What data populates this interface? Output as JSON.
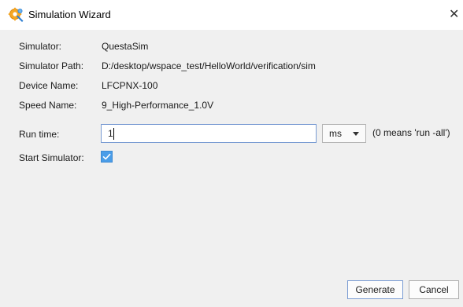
{
  "window": {
    "title": "Simulation Wizard",
    "close_glyph": "✕"
  },
  "fields": {
    "simulator": {
      "label": "Simulator:",
      "value": "QuestaSim"
    },
    "simulator_path": {
      "label": "Simulator Path:",
      "value": "D:/desktop/wspace_test/HelloWorld/verification/sim"
    },
    "device_name": {
      "label": "Device Name:",
      "value": "LFCPNX-100"
    },
    "speed_name": {
      "label": "Speed Name:",
      "value": "9_High-Performance_1.0V"
    }
  },
  "run_time": {
    "label": "Run time:",
    "value": "1",
    "unit": "ms",
    "hint": "(0 means 'run -all')"
  },
  "start_simulator": {
    "label": "Start Simulator:",
    "checked": true
  },
  "buttons": {
    "generate": "Generate",
    "cancel": "Cancel"
  },
  "icons": {
    "title_icon": "simulation-wizard-gear-icon",
    "checkbox_check": "checkmark-icon",
    "dropdown_arrow": "chevron-down-icon"
  },
  "colors": {
    "checkbox_fill": "#4a9de8",
    "input_focus_border": "#7a9cd3",
    "dialog_bg": "#f0f0f0"
  }
}
